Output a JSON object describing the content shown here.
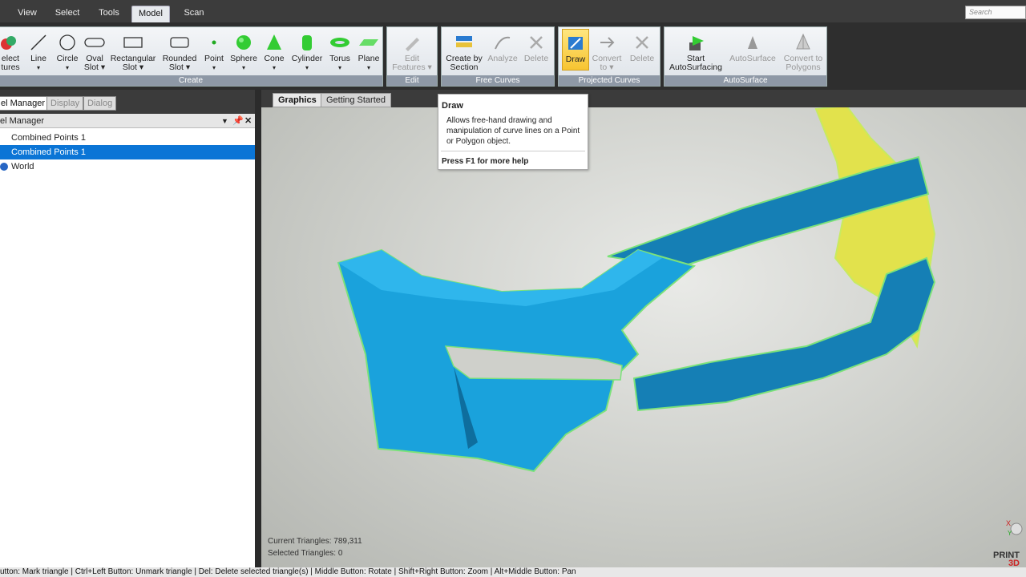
{
  "menu": {
    "tabs": [
      "View",
      "Select",
      "Tools",
      "Model",
      "Scan"
    ],
    "active": "Model",
    "search_placeholder": "Search"
  },
  "ribbon": {
    "create": {
      "label": "Create",
      "buttons": [
        {
          "l1": "elect",
          "l2": "tures"
        },
        {
          "l1": "Line",
          "l2": "▾"
        },
        {
          "l1": "Circle",
          "l2": "▾"
        },
        {
          "l1": "Oval",
          "l2": "Slot ▾"
        },
        {
          "l1": "Rectangular",
          "l2": "Slot ▾"
        },
        {
          "l1": "Rounded",
          "l2": "Slot ▾"
        },
        {
          "l1": "Point",
          "l2": "▾"
        },
        {
          "l1": "Sphere",
          "l2": "▾"
        },
        {
          "l1": "Cone",
          "l2": "▾"
        },
        {
          "l1": "Cylinder",
          "l2": "▾"
        },
        {
          "l1": "Torus",
          "l2": "▾"
        },
        {
          "l1": "Plane",
          "l2": "▾"
        }
      ]
    },
    "edit": {
      "label": "Edit",
      "buttons": [
        {
          "l1": "Edit",
          "l2": "Features ▾"
        }
      ]
    },
    "free_curves": {
      "label": "Free Curves",
      "buttons": [
        {
          "l1": "Create by",
          "l2": "Section"
        },
        {
          "l1": "Analyze",
          "l2": ""
        },
        {
          "l1": "Delete",
          "l2": ""
        }
      ]
    },
    "projected_curves": {
      "label": "Projected Curves",
      "buttons": [
        {
          "l1": "Draw",
          "l2": ""
        },
        {
          "l1": "Convert",
          "l2": "to ▾"
        },
        {
          "l1": "Delete",
          "l2": ""
        }
      ]
    },
    "autosurface": {
      "label": "AutoSurface",
      "buttons": [
        {
          "l1": "Start",
          "l2": "AutoSurfacing"
        },
        {
          "l1": "AutoSurface",
          "l2": ""
        },
        {
          "l1": "Convert to",
          "l2": "Polygons"
        }
      ]
    }
  },
  "panel": {
    "tabs": [
      "el Manager",
      "Display",
      "Dialog"
    ],
    "header": "el Manager",
    "tree": [
      "Combined Points 1",
      "Combined Points 1",
      "World"
    ],
    "selected_index": 1
  },
  "viewport": {
    "tabs": [
      "Graphics",
      "Getting Started"
    ],
    "active": "Graphics"
  },
  "tooltip": {
    "title": "Draw",
    "body": "Allows free-hand drawing and manipulation of curve lines on a Point or Polygon object.",
    "help": "Press F1 for more help"
  },
  "stats": {
    "current": "Current Triangles: 789,311",
    "selected": "Selected Triangles: 0"
  },
  "status": "utton: Mark triangle | Ctrl+Left Button: Unmark triangle | Del: Delete selected triangle(s) | Middle Button: Rotate | Shift+Right Button: Zoom | Alt+Middle Button: Pan",
  "logo": {
    "line1": "PRINT",
    "line2": "3D"
  },
  "colors": {
    "selection": "#0b75d6",
    "model_blue": "#1a9fd6",
    "model_yellow": "#e2e24c",
    "highlight": "#f7c431"
  }
}
